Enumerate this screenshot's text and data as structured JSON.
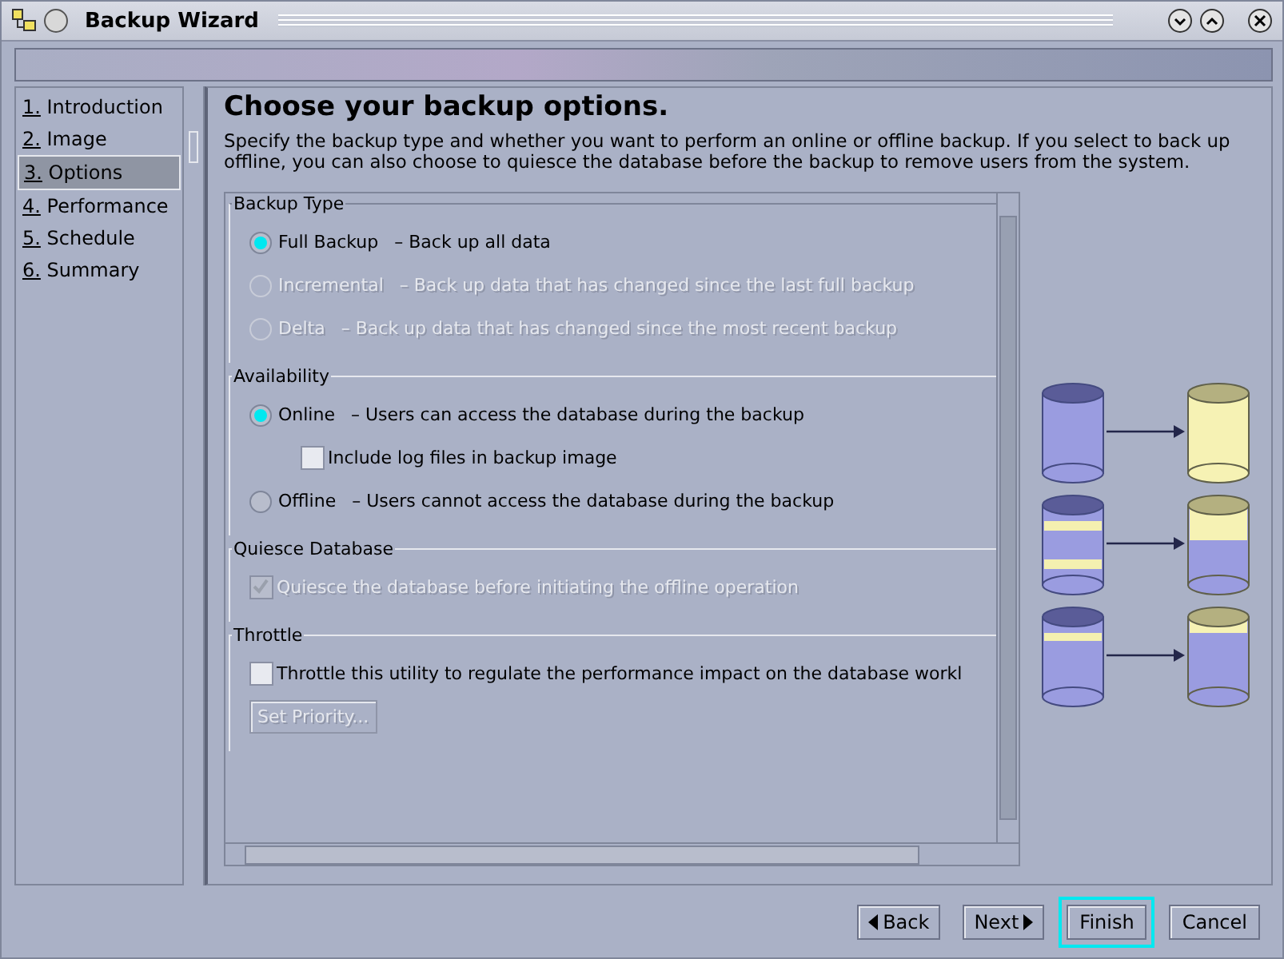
{
  "window": {
    "title": "Backup Wizard"
  },
  "steps": [
    {
      "number": "1.",
      "label": "Introduction",
      "selected": false
    },
    {
      "number": "2.",
      "label": "Image",
      "selected": false
    },
    {
      "number": "3.",
      "label": "Options",
      "selected": true
    },
    {
      "number": "4.",
      "label": "Performance",
      "selected": false
    },
    {
      "number": "5.",
      "label": "Schedule",
      "selected": false
    },
    {
      "number": "6.",
      "label": "Summary",
      "selected": false
    }
  ],
  "heading": "Choose your backup options.",
  "description": "Specify the backup type and whether you want to perform an online or offline backup. If you select to back up offline, you can also choose to quiesce the database before the backup to remove users from the system.",
  "groups": [
    {
      "title": "Backup Type",
      "options": [
        {
          "kind": "radio",
          "label": "Full Backup",
          "description": "–  Back up all data",
          "selected": true,
          "disabled": false
        },
        {
          "kind": "radio",
          "label": "Incremental",
          "description": "–  Back up data that has changed since the last full backup",
          "selected": false,
          "disabled": true
        },
        {
          "kind": "radio",
          "label": "Delta",
          "description": "–  Back up data that has changed since the most recent backup",
          "selected": false,
          "disabled": true
        }
      ]
    },
    {
      "title": "Availability",
      "options": [
        {
          "kind": "radio",
          "label": "Online",
          "description": "–  Users can access the database during the backup",
          "selected": true,
          "disabled": false,
          "children": [
            {
              "kind": "checkbox",
              "label": "Include log files in backup image",
              "checked": false,
              "disabled": false
            }
          ]
        },
        {
          "kind": "radio",
          "label": "Offline",
          "description": "–  Users cannot access the database during the backup",
          "selected": false,
          "disabled": false
        }
      ]
    },
    {
      "title": "Quiesce Database",
      "options": [
        {
          "kind": "checkbox",
          "label": "Quiesce the database before initiating the offline operation",
          "checked": true,
          "disabled": true
        }
      ]
    },
    {
      "title": "Throttle",
      "options": [
        {
          "kind": "checkbox",
          "label": "Throttle this utility to regulate the performance impact on the database workl",
          "checked": false,
          "disabled": false
        },
        {
          "kind": "button",
          "label": "Set Priority...",
          "disabled": true
        }
      ]
    }
  ],
  "buttons": [
    {
      "kind": "back",
      "label": "Back",
      "focused": false
    },
    {
      "kind": "next",
      "label": "Next",
      "focused": false
    },
    {
      "kind": "plain",
      "label": "Finish",
      "focused": true
    },
    {
      "kind": "plain",
      "label": "Cancel",
      "focused": false
    }
  ]
}
